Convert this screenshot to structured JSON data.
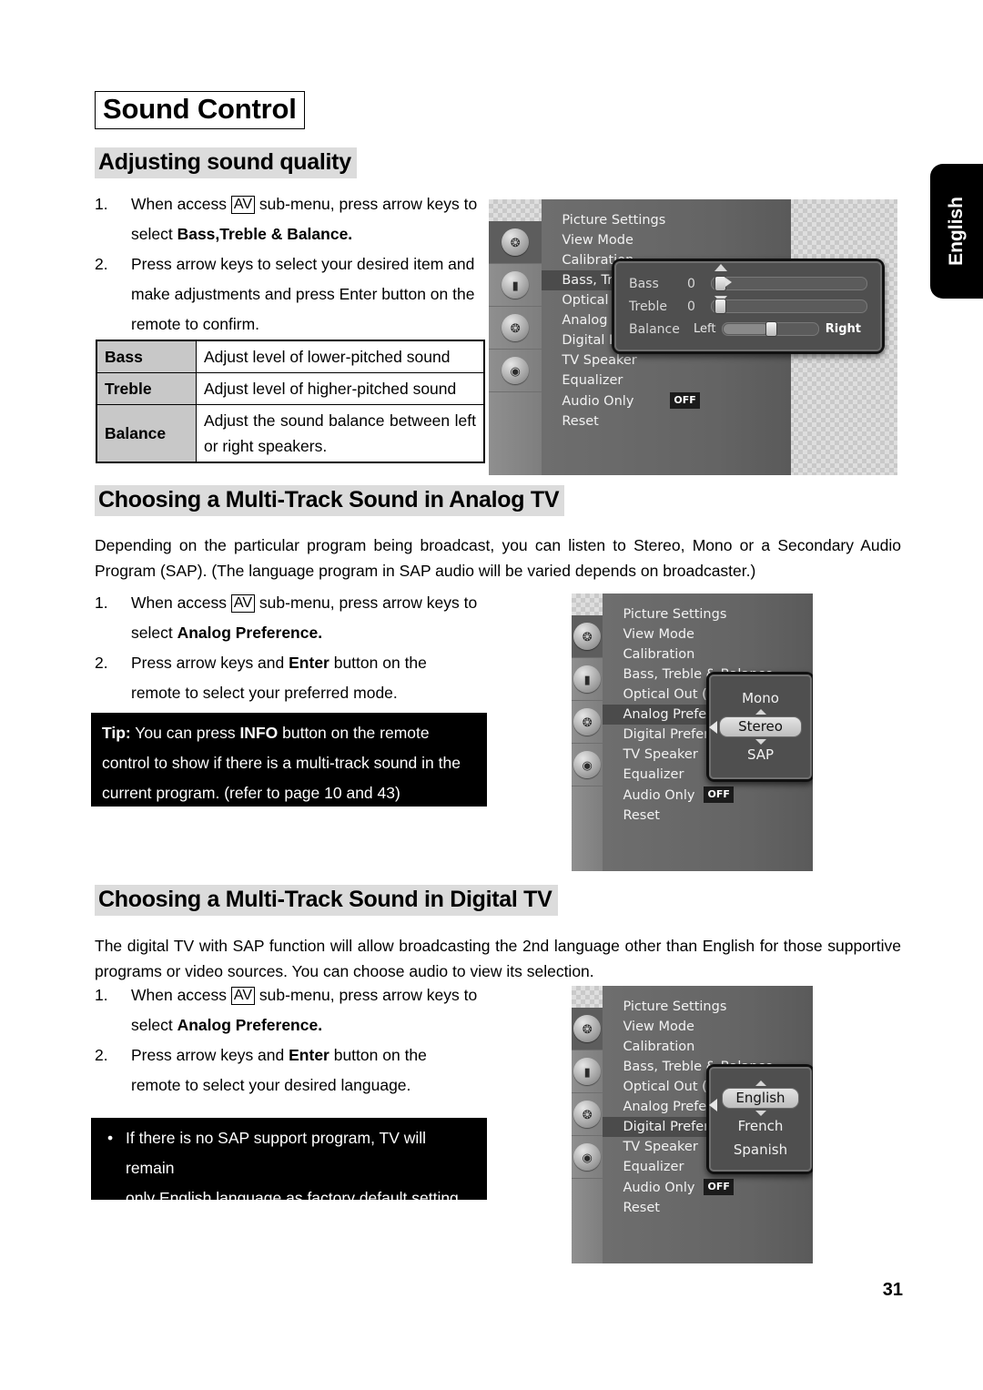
{
  "page": {
    "title": "Sound Control",
    "number": "31",
    "language_tab": "English"
  },
  "sections": [
    {
      "heading": "Adjusting sound quality",
      "steps": [
        {
          "num": "1.",
          "lines": [
            "When access [AV] sub-menu, press arrow keys to",
            "select Bass,Treble & Balance."
          ]
        },
        {
          "num": "2.",
          "lines": [
            "Press arrow keys to select your desired item and",
            "make adjustments and press Enter button on the",
            "remote to confirm."
          ]
        }
      ],
      "table": {
        "rows": [
          {
            "key": "Bass",
            "value": "Adjust level of lower-pitched sound"
          },
          {
            "key": "Treble",
            "value": "Adjust level of higher-pitched sound"
          },
          {
            "key": "Balance",
            "value": "Adjust the sound balance between left or right speakers."
          }
        ]
      }
    },
    {
      "heading": "Choosing a Multi-Track Sound in Analog TV",
      "paragraph": "Depending on the particular program being broadcast, you can listen to Stereo, Mono or a Secondary Audio Program (SAP). (The language program in SAP audio will be varied depends on broadcaster.)",
      "steps": [
        {
          "num": "1.",
          "lines": [
            "When access [AV] sub-menu, press arrow keys to",
            "select Analog Preference."
          ]
        },
        {
          "num": "2.",
          "lines": [
            "Press arrow keys and Enter button on the",
            "remote to select your preferred mode."
          ]
        }
      ],
      "note": {
        "style": "tip",
        "lines": [
          "Tip: You can press INFO button on the remote",
          "control to show if there is a multi-track sound in the",
          "current program. (refer to page 10 and 43)"
        ]
      }
    },
    {
      "heading": "Choosing a Multi-Track Sound in Digital TV",
      "paragraph": "The digital TV with SAP function will allow broadcasting the 2nd language other than English for those supportive programs or video sources. You can choose audio to view its selection.",
      "steps": [
        {
          "num": "1.",
          "lines": [
            "When access [AV] sub-menu, press arrow keys to",
            "select Analog Preference."
          ]
        },
        {
          "num": "2.",
          "lines": [
            "Press arrow keys and Enter button on the",
            "remote to select your desired language."
          ]
        }
      ],
      "note": {
        "style": "bullet",
        "lines": [
          "If there is no SAP support program, TV will remain",
          "only English language as factory default setting."
        ]
      }
    }
  ],
  "osd": {
    "icon_strip": [
      {
        "name": "picture-icon",
        "glyph": "❂",
        "selected": true
      },
      {
        "name": "display-icon",
        "glyph": "▬",
        "selected": false
      },
      {
        "name": "audio-icon",
        "glyph": "⁂",
        "selected": false
      },
      {
        "name": "camera-icon",
        "glyph": "◉",
        "selected": false
      }
    ],
    "menu_items": [
      "Picture Settings",
      "View Mode",
      "Calibration",
      "Bass, Treble & Balance",
      "Optical Out (SPD",
      "Analog Preference",
      "Digital Preference",
      "TV Speaker",
      "Equalizer",
      "Audio Only",
      "Reset"
    ],
    "audio_only_value": "OFF",
    "shot1": {
      "selected_item": "Bass, Treble & Balance",
      "sliders": [
        {
          "label": "Bass",
          "value": "0",
          "pos_pct": 2,
          "focused": true
        },
        {
          "label": "Treble",
          "value": "0",
          "pos_pct": 2,
          "focused": false
        }
      ],
      "balance": {
        "label": "Balance",
        "left": "Left",
        "right": "Right",
        "pos_pct": 47
      }
    },
    "shot2": {
      "selected_item": "Analog Preference",
      "options": [
        "Mono",
        "Stereo",
        "SAP"
      ],
      "current": "Stereo"
    },
    "shot3": {
      "selected_item": "Digital Preference",
      "options": [
        "English",
        "French",
        "Spanish"
      ],
      "current": "English"
    }
  }
}
